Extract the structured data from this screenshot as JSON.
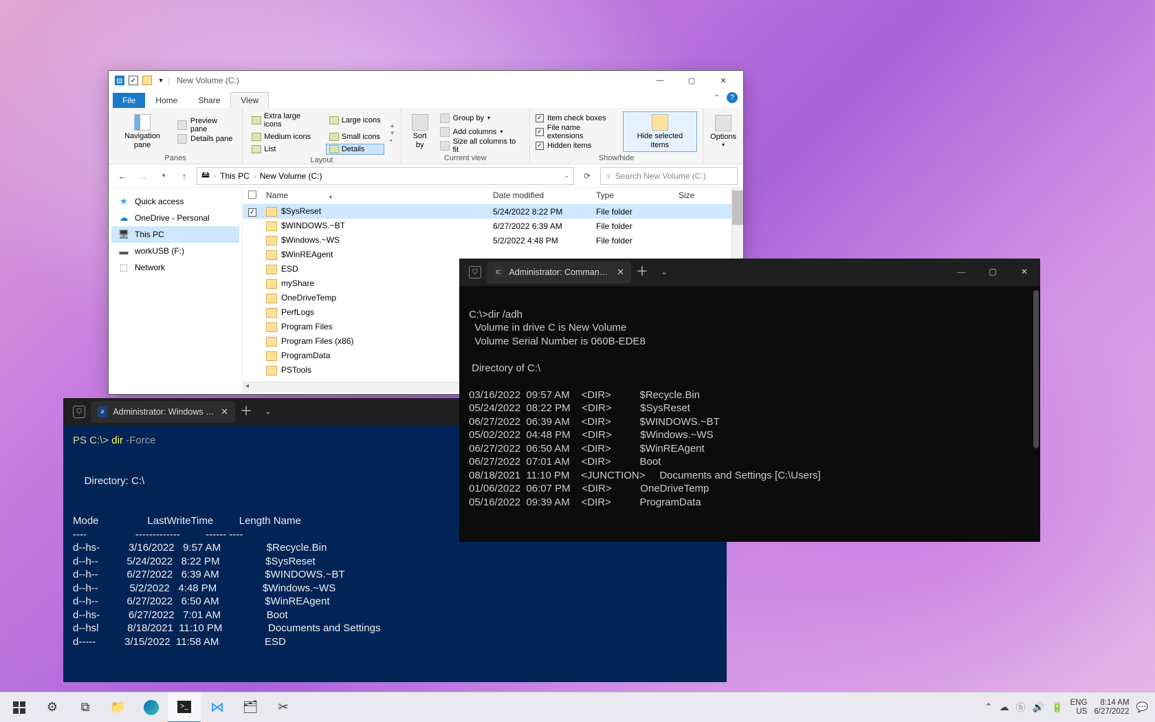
{
  "explorer": {
    "title": "New Volume (C:)",
    "tabs": {
      "file": "File",
      "home": "Home",
      "share": "Share",
      "view": "View"
    },
    "ribbon": {
      "panes": {
        "group": "Panes",
        "nav": "Navigation pane",
        "preview": "Preview pane",
        "details": "Details pane"
      },
      "layout": {
        "group": "Layout",
        "xl": "Extra large icons",
        "lg": "Large icons",
        "md": "Medium icons",
        "sm": "Small icons",
        "list": "List",
        "details": "Details"
      },
      "currentview": {
        "group": "Current view",
        "sort": "Sort by",
        "group_by": "Group by",
        "add_cols": "Add columns",
        "size_all": "Size all columns to fit"
      },
      "showhide": {
        "group": "Show/hide",
        "item_check": "Item check boxes",
        "ext": "File name extensions",
        "hidden": "Hidden items",
        "hide_sel": "Hide selected items"
      },
      "options": "Options"
    },
    "address": {
      "this_pc": "This PC",
      "vol": "New Volume (C:)"
    },
    "search_placeholder": "Search New Volume (C:)",
    "nav_items": [
      {
        "icon": "★",
        "label": "Quick access",
        "color": "#3a9be8"
      },
      {
        "icon": "☁",
        "label": "OneDrive - Personal",
        "color": "#0f7ad6"
      },
      {
        "icon": "🖥",
        "label": "This PC",
        "color": "#333",
        "sel": true
      },
      {
        "icon": "▬",
        "label": "workUSB (F:)",
        "color": "#555"
      },
      {
        "icon": "⬚",
        "label": "Network",
        "color": "#555"
      }
    ],
    "cols": {
      "name": "Name",
      "mod": "Date modified",
      "type": "Type",
      "size": "Size"
    },
    "rows": [
      {
        "sel": true,
        "chk": true,
        "name": "$SysReset",
        "mod": "5/24/2022 8:22 PM",
        "type": "File folder"
      },
      {
        "name": "$WINDOWS.~BT",
        "mod": "6/27/2022 6:39 AM",
        "type": "File folder"
      },
      {
        "name": "$Windows.~WS",
        "mod": "5/2/2022 4:48 PM",
        "type": "File folder"
      },
      {
        "name": "$WinREAgent",
        "mod": "",
        "type": ""
      },
      {
        "name": "ESD",
        "mod": "",
        "type": ""
      },
      {
        "name": "myShare",
        "mod": "",
        "type": ""
      },
      {
        "name": "OneDriveTemp",
        "mod": "",
        "type": ""
      },
      {
        "name": "PerfLogs",
        "mod": "",
        "type": ""
      },
      {
        "name": "Program Files",
        "mod": "",
        "type": ""
      },
      {
        "name": "Program Files (x86)",
        "mod": "",
        "type": ""
      },
      {
        "name": "ProgramData",
        "mod": "",
        "type": ""
      },
      {
        "name": "PSTools",
        "mod": "",
        "type": ""
      }
    ]
  },
  "cmd": {
    "tab": "Administrator: Command Pror",
    "lines": [
      "C:\\>dir /adh",
      "  Volume in drive C is New Volume",
      "  Volume Serial Number is 060B-EDE8",
      "",
      " Directory of C:\\",
      "",
      "03/16/2022  09:57 AM    <DIR>          $Recycle.Bin",
      "05/24/2022  08:22 PM    <DIR>          $SysReset",
      "06/27/2022  06:39 AM    <DIR>          $WINDOWS.~BT",
      "05/02/2022  04:48 PM    <DIR>          $Windows.~WS",
      "06/27/2022  06:50 AM    <DIR>          $WinREAgent",
      "06/27/2022  07:01 AM    <DIR>          Boot",
      "08/18/2021  11:10 PM    <JUNCTION>     Documents and Settings [C:\\Users]",
      "01/06/2022  06:07 PM    <DIR>          OneDriveTemp",
      "05/16/2022  09:39 AM    <DIR>          ProgramData"
    ]
  },
  "ps": {
    "tab": "Administrator: Windows Powe",
    "prompt": "PS C:\\>",
    "cmd": "dir",
    "arg": "-Force",
    "header": "    Directory: C:\\",
    "cols": "Mode                 LastWriteTime         Length Name",
    "sep": "----                 -------------         ------ ----",
    "rows": [
      "d--hs-          3/16/2022   9:57 AM                $Recycle.Bin",
      "d--h--          5/24/2022   8:22 PM                $SysReset",
      "d--h--          6/27/2022   6:39 AM                $WINDOWS.~BT",
      "d--h--           5/2/2022   4:48 PM                $Windows.~WS",
      "d--h--          6/27/2022   6:50 AM                $WinREAgent",
      "d--hs-          6/27/2022   7:01 AM                Boot",
      "d--hsl          8/18/2021  11:10 PM                Documents and Settings",
      "d-----          3/15/2022  11:58 AM                ESD"
    ]
  },
  "taskbar": {
    "lang": "ENG",
    "locale": "US",
    "time": "8:14 AM",
    "date": "6/27/2022"
  }
}
